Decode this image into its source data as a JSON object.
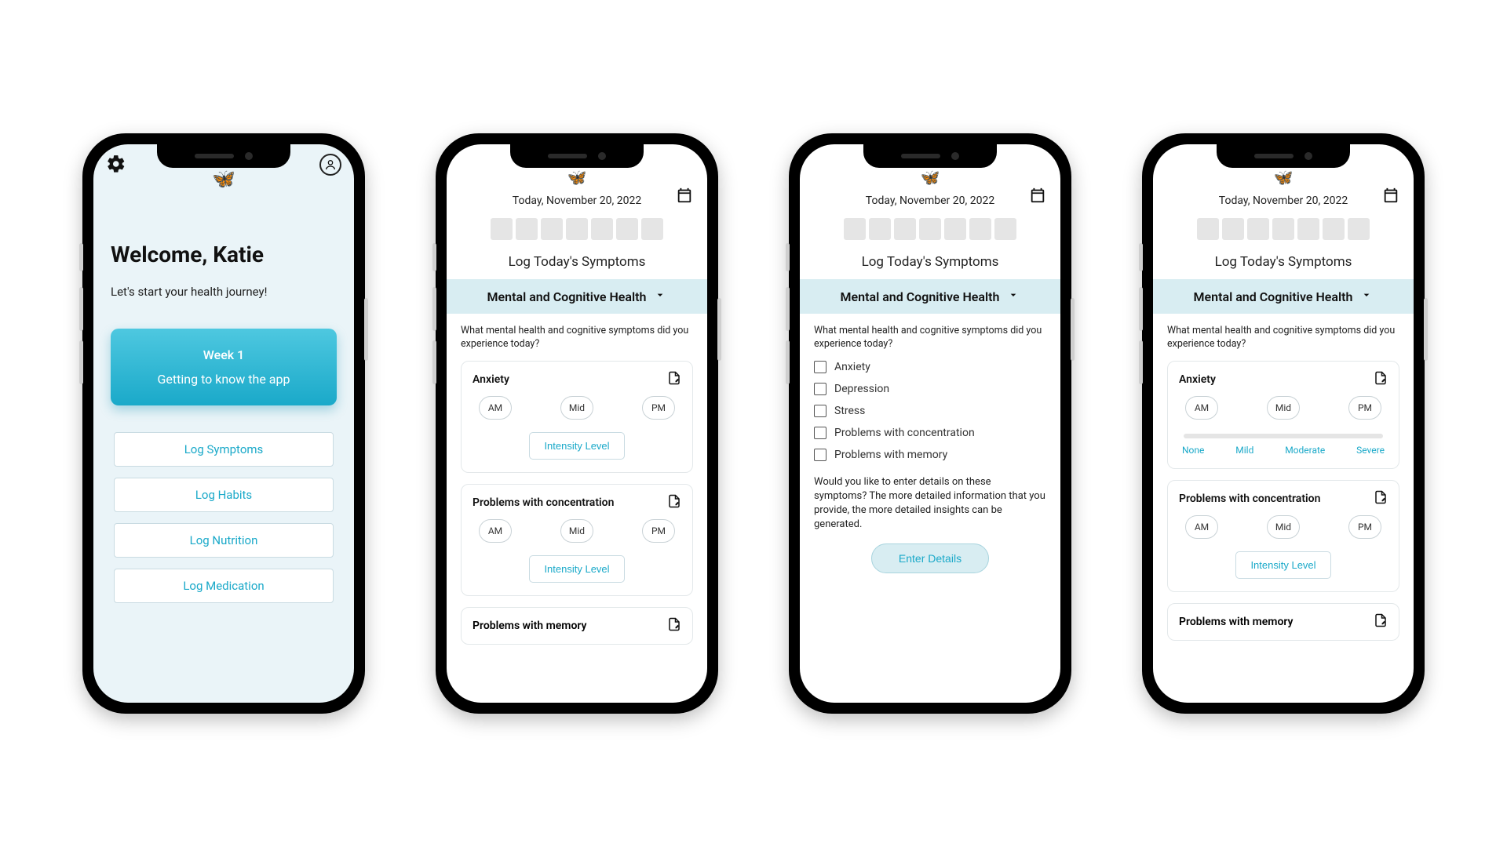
{
  "home": {
    "welcome": "Welcome, Katie",
    "subtitle": "Let's start your health journey!",
    "week_title": "Week 1",
    "week_desc": "Getting to know the app",
    "buttons": [
      "Log Symptoms",
      "Log Habits",
      "Log Nutrition",
      "Log Medication"
    ]
  },
  "log": {
    "date": "Today, November 20, 2022",
    "title": "Log Today's Symptoms",
    "section": "Mental and Cognitive Health",
    "prompt": "What mental health and cognitive symptoms did you experience today?",
    "time_options": [
      "AM",
      "Mid",
      "PM"
    ],
    "intensity_btn": "Intensity Level",
    "intensity_levels": [
      "None",
      "Mild",
      "Moderate",
      "Severe"
    ],
    "symptoms": {
      "anxiety": "Anxiety",
      "concentration": "Problems with concentration",
      "memory": "Problems with memory"
    },
    "checklist": [
      "Anxiety",
      "Depression",
      "Stress",
      "Problems with concentration",
      "Problems with memory"
    ],
    "detail_prompt": "Would you like to enter details on these symptoms? The more detailed information that you provide, the more detailed insights can be generated.",
    "enter_details": "Enter Details"
  },
  "colors": {
    "accent": "#1aa9c9",
    "section_bg": "#d8edf2",
    "screen_bg": "#eaf4f8"
  }
}
